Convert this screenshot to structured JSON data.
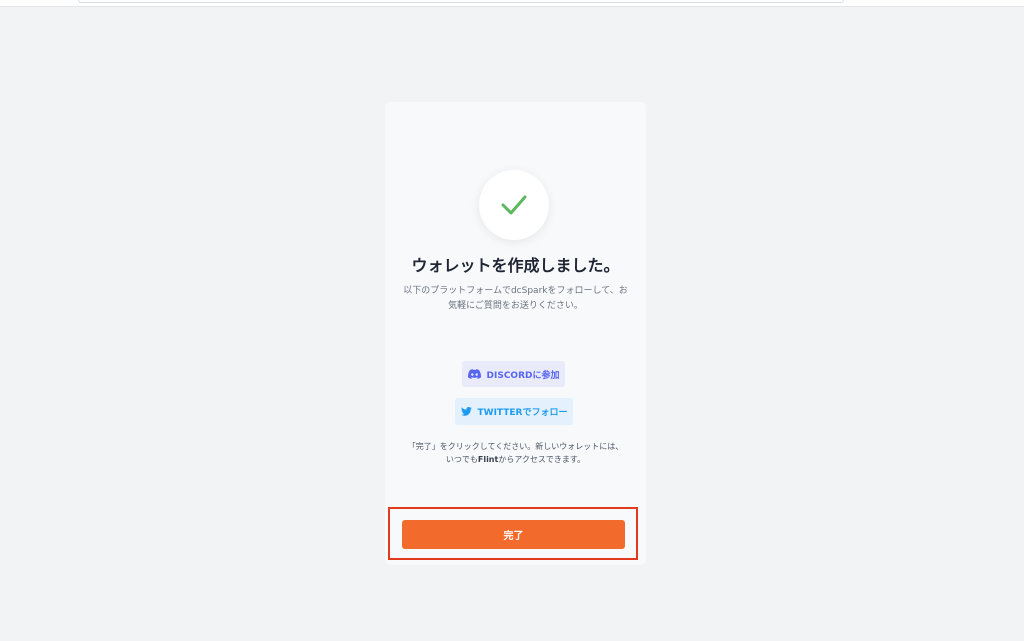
{
  "dialog": {
    "title": "ウォレットを作成しました。",
    "description": "以下のプラットフォームでdcSparkをフォローして、お気軽にご質問をお送りください。",
    "discord_button": "DISCORDに参加",
    "twitter_button": "TWITTERでフォロー",
    "note_before": "「完了」をクリックしてください。新しいウォレットには、いつでも",
    "note_brand": "Flint",
    "note_after": "からアクセスできます。",
    "done_button": "完了"
  },
  "colors": {
    "check": "#5cb85c",
    "discord": "#5865f2",
    "twitter": "#1d9bf0",
    "done_button": "#f26b2d",
    "highlight_border": "#e23a1e"
  },
  "icons": {
    "success": "check-icon",
    "discord": "discord-icon",
    "twitter": "twitter-icon"
  }
}
